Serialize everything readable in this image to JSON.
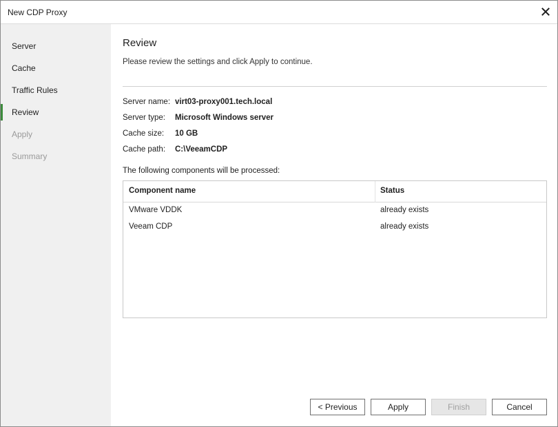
{
  "window": {
    "title": "New CDP Proxy",
    "close_icon": "close-icon"
  },
  "sidebar": {
    "items": [
      {
        "label": "Server",
        "state": "normal"
      },
      {
        "label": "Cache",
        "state": "normal"
      },
      {
        "label": "Traffic Rules",
        "state": "normal"
      },
      {
        "label": "Review",
        "state": "active"
      },
      {
        "label": "Apply",
        "state": "disabled"
      },
      {
        "label": "Summary",
        "state": "disabled"
      }
    ]
  },
  "main": {
    "title": "Review",
    "description": "Please review the settings and click Apply to continue.",
    "info": [
      {
        "label": "Server name:",
        "value": "virt03-proxy001.tech.local"
      },
      {
        "label": "Server type:",
        "value": "Microsoft Windows server"
      },
      {
        "label": "Cache size:",
        "value": "10 GB"
      },
      {
        "label": "Cache path:",
        "value": "C:\\VeeamCDP"
      }
    ],
    "components_label": "The following components will be processed:",
    "table": {
      "columns": [
        "Component name",
        "Status"
      ],
      "rows": [
        [
          "VMware VDDK",
          "already exists"
        ],
        [
          "Veeam CDP",
          "already exists"
        ]
      ]
    }
  },
  "buttons": {
    "previous": "< Previous",
    "apply": "Apply",
    "finish": "Finish",
    "cancel": "Cancel"
  },
  "colors": {
    "accent": "#3c8a3c",
    "sidebar_bg": "#f0f0f0"
  }
}
